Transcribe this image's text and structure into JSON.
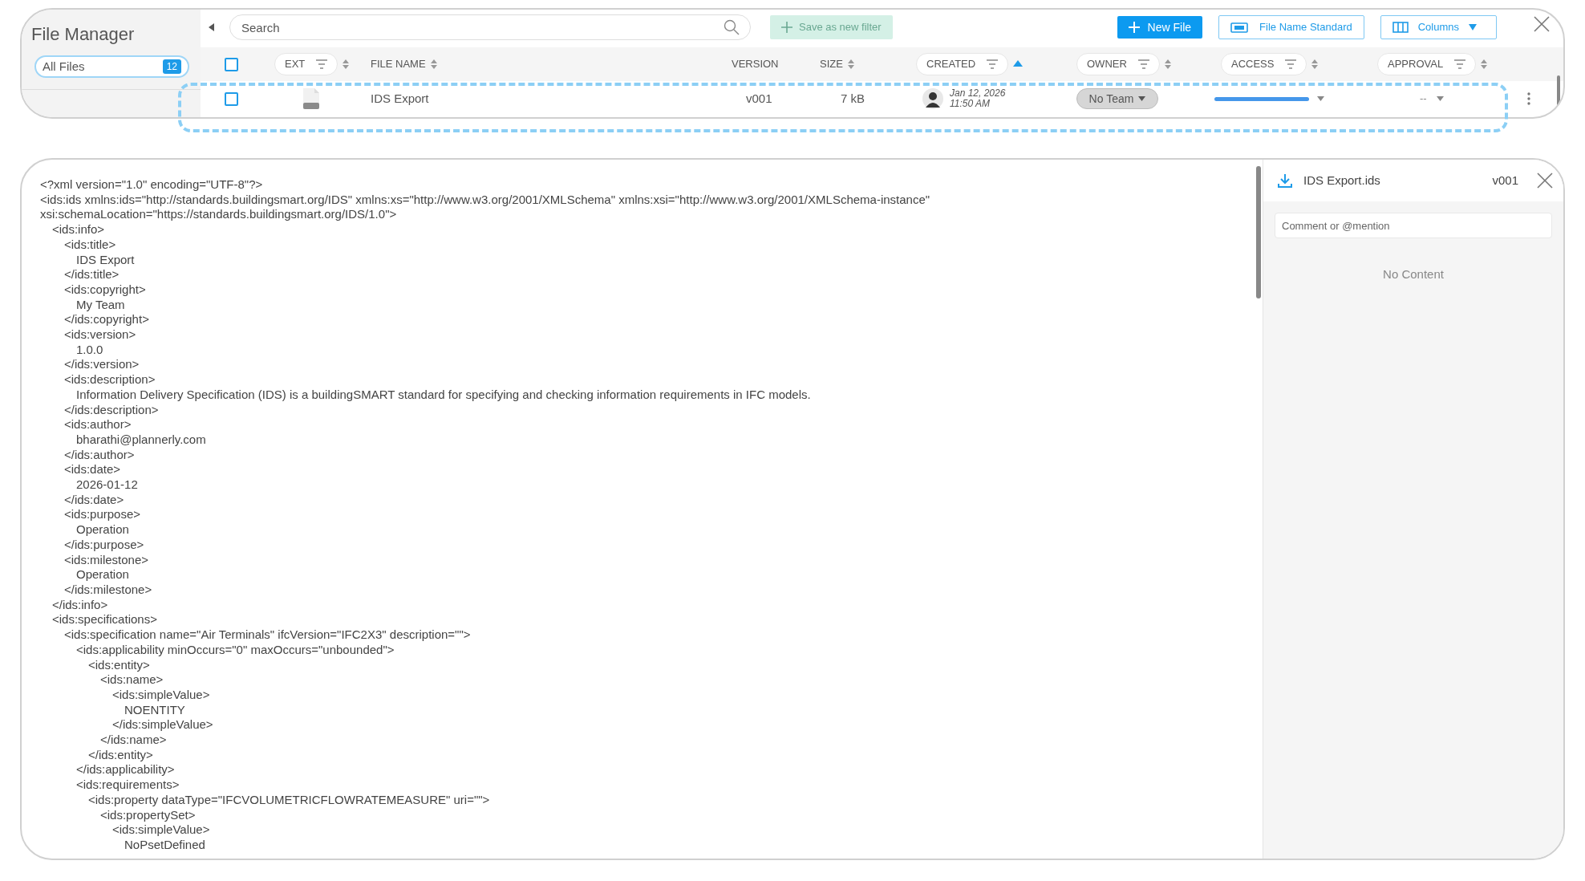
{
  "sidebar": {
    "title": "File Manager",
    "items": [
      {
        "label": "All Files",
        "count": "12",
        "selected": true
      }
    ]
  },
  "toolbar": {
    "search": {
      "placeholder": "Search"
    },
    "buttons": [
      {
        "kind": "save-filter",
        "label": "Save as new filter",
        "disabled": true
      },
      {
        "kind": "new-file",
        "label": "New File",
        "disabled": false
      },
      {
        "kind": "name-standard",
        "label": "File Name Standard",
        "disabled": false
      },
      {
        "kind": "columns",
        "label": "Columns",
        "disabled": false
      }
    ]
  },
  "table": {
    "columns": [
      {
        "kind": "checkbox",
        "checked": false
      },
      {
        "kind": "pill",
        "label": "EXT",
        "sortable": true,
        "sorted_ascending": false
      },
      {
        "kind": "plain",
        "label": "FILE NAME",
        "sortable": true,
        "sorted_ascending": false
      },
      {
        "kind": "plain",
        "label": "VERSION",
        "sortable": false,
        "sorted_ascending": false
      },
      {
        "kind": "plain",
        "label": "SIZE",
        "sortable": true,
        "sorted_ascending": false
      },
      {
        "kind": "pill",
        "label": "CREATED",
        "sortable": true,
        "sorted_ascending": true
      },
      {
        "kind": "pill",
        "label": "OWNER",
        "sortable": true,
        "sorted_ascending": false
      },
      {
        "kind": "pill",
        "label": "ACCESS",
        "sortable": true,
        "sorted_ascending": false
      },
      {
        "kind": "pill",
        "label": "APPROVAL",
        "sortable": true,
        "sorted_ascending": false
      }
    ],
    "rows": [
      {
        "checked": false,
        "file_name": "IDS Export",
        "version": "v001",
        "size": "7 kB",
        "created_date": "Jan 12, 2026",
        "created_time": "11:50 AM",
        "owner": "No Team",
        "approval": "--"
      }
    ]
  },
  "editor": {
    "lines": [
      {
        "text": "<?xml version=\"1.0\" encoding=\"UTF-8\"?>"
      },
      {
        "text": "<ids:ids xmlns:ids=\"http://standards.buildingsmart.org/IDS\" xmlns:xs=\"http://www.w3.org/2001/XMLSchema\" xmlns:xsi=\"http://www.w3.org/2001/XMLSchema-instance\""
      },
      {
        "text": "xsi:schemaLocation=\"https://standards.buildingsmart.org/IDS/1.0\">",
        "children": [
          {
            "text": "<ids:info>",
            "children": [
              {
                "text": "<ids:title>",
                "children": [
                  {
                    "text": "IDS Export"
                  }
                ]
              },
              {
                "text": "</ids:title>"
              },
              {
                "text": "<ids:copyright>",
                "children": [
                  {
                    "text": "My Team"
                  }
                ]
              },
              {
                "text": "</ids:copyright>"
              },
              {
                "text": "<ids:version>",
                "children": [
                  {
                    "text": "1.0.0"
                  }
                ]
              },
              {
                "text": "</ids:version>"
              },
              {
                "text": "<ids:description>",
                "children": [
                  {
                    "text": "Information Delivery Specification (IDS) is a buildingSMART standard for specifying and checking information requirements in IFC models."
                  }
                ]
              },
              {
                "text": "</ids:description>"
              },
              {
                "text": "<ids:author>",
                "children": [
                  {
                    "text": "bharathi@plannerly.com"
                  }
                ]
              },
              {
                "text": "</ids:author>"
              },
              {
                "text": "<ids:date>",
                "children": [
                  {
                    "text": "2026-01-12"
                  }
                ]
              },
              {
                "text": "</ids:date>"
              },
              {
                "text": "<ids:purpose>",
                "children": [
                  {
                    "text": "Operation"
                  }
                ]
              },
              {
                "text": "</ids:purpose>"
              },
              {
                "text": "<ids:milestone>",
                "children": [
                  {
                    "text": "Operation"
                  }
                ]
              },
              {
                "text": "</ids:milestone>"
              }
            ]
          },
          {
            "text": "</ids:info>"
          },
          {
            "text": "<ids:specifications>",
            "children": [
              {
                "text": "<ids:specification name=\"Air Terminals\" ifcVersion=\"IFC2X3\" description=\"\">",
                "children": [
                  {
                    "text": "<ids:applicability minOccurs=\"0\" maxOccurs=\"unbounded\">",
                    "children": [
                      {
                        "text": "<ids:entity>",
                        "children": [
                          {
                            "text": "<ids:name>",
                            "children": [
                              {
                                "text": "<ids:simpleValue>",
                                "children": [
                                  {
                                    "text": "NOENTITY"
                                  }
                                ]
                              },
                              {
                                "text": "</ids:simpleValue>"
                              }
                            ]
                          },
                          {
                            "text": "</ids:name>"
                          }
                        ]
                      },
                      {
                        "text": "</ids:entity>"
                      }
                    ]
                  },
                  {
                    "text": "</ids:applicability>"
                  },
                  {
                    "text": "<ids:requirements>",
                    "children": [
                      {
                        "text": "<ids:property dataType=\"IFCVOLUMETRICFLOWRATEMEASURE\" uri=\"\">",
                        "children": [
                          {
                            "text": "<ids:propertySet>",
                            "children": [
                              {
                                "text": "<ids:simpleValue>",
                                "children": [
                                  {
                                    "text": "NoPsetDefined"
                                  }
                                ]
                              }
                            ]
                          }
                        ]
                      }
                    ]
                  }
                ]
              }
            ]
          }
        ]
      }
    ]
  },
  "comments": {
    "file_name": "IDS Export.ids",
    "version": "v001",
    "placeholder": "Comment or @mention",
    "empty_text": "No Content"
  }
}
